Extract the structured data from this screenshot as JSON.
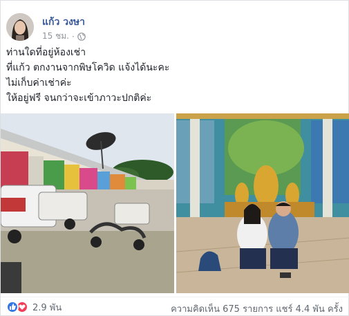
{
  "post": {
    "author": "แก้ว วงษา",
    "time": "15 ชม.",
    "privacy_icon": "globe-icon",
    "more_icon": "more-options-icon",
    "text_lines": [
      "ท่านใดที่อยู่ห้องเช่า",
      "ที่แก้ว ตกงานจากพิษโควิด แจ้งได้นะคะ",
      "ไม่เก็บค่าเช่าค่ะ",
      "ให้อยู่ฟรี จนกว่าจะเข้าภาวะปกติค่ะ"
    ]
  },
  "footer": {
    "reaction_icons": [
      "like-icon",
      "love-icon"
    ],
    "reaction_count": "2.9 พัน",
    "stats": "ความคิดเห็น 675 รายการ แชร์ 4.4 พัน ครั้ง"
  },
  "colors": {
    "author": "#385898",
    "like": "#3578e5",
    "love": "#f33e58",
    "muted": "#90949c"
  }
}
